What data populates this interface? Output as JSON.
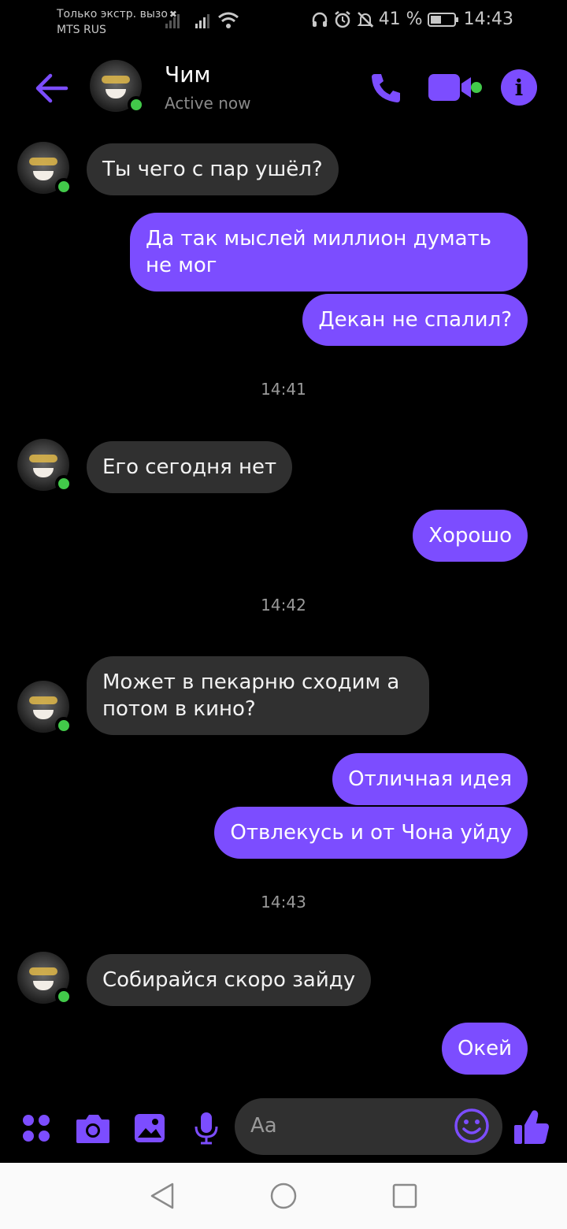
{
  "status_bar": {
    "carrier_line1": "Только экстр. вызо",
    "carrier_line2": "MTS RUS",
    "battery_percent": "41 %",
    "time": "14:43"
  },
  "header": {
    "contact_name": "Чим",
    "contact_status": "Active now"
  },
  "conversation": {
    "messages": [
      {
        "direction": "incoming",
        "text": "Ты чего с пар ушёл?"
      },
      {
        "direction": "outgoing",
        "text": "Да так мыслей миллион думать не мог"
      },
      {
        "direction": "outgoing",
        "text": "Декан не спалил?"
      },
      {
        "direction": "timestamp",
        "text": "14:41"
      },
      {
        "direction": "incoming",
        "text": "Его сегодня нет"
      },
      {
        "direction": "outgoing",
        "text": "Хорошо"
      },
      {
        "direction": "timestamp",
        "text": "14:42"
      },
      {
        "direction": "incoming",
        "text": "Может в пекарню сходим а потом в кино?"
      },
      {
        "direction": "outgoing",
        "text": "Отличная идея"
      },
      {
        "direction": "outgoing",
        "text": "Отвлекусь и от Чона уйду"
      },
      {
        "direction": "timestamp",
        "text": "14:43"
      },
      {
        "direction": "incoming",
        "text": "Собирайся скоро зайду"
      },
      {
        "direction": "outgoing",
        "text": "Окей"
      }
    ]
  },
  "composer": {
    "placeholder": "Aa"
  },
  "colors": {
    "accent": "#7c4dff",
    "incoming_bubble": "#303030",
    "online": "#42c94a",
    "background": "#000000"
  },
  "icons": [
    "back-arrow-icon",
    "phone-icon",
    "video-camera-icon",
    "info-icon",
    "apps-icon",
    "camera-icon",
    "gallery-icon",
    "microphone-icon",
    "emoji-icon",
    "thumbs-up-icon",
    "nav-back-icon",
    "nav-home-icon",
    "nav-recents-icon"
  ]
}
